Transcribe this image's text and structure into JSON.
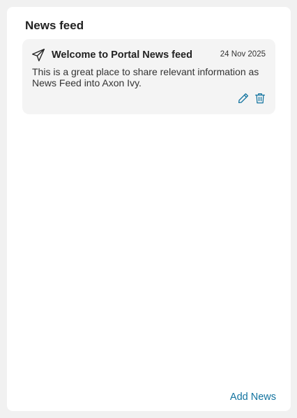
{
  "panel": {
    "title": "News feed",
    "add_news_label": "Add News"
  },
  "news_items": [
    {
      "icon": "send-icon",
      "title": "Welcome to Portal News feed",
      "date": "24 Nov 2025",
      "body": "This is a great place to share relevant information as News Feed into Axon Ivy.",
      "actions": [
        "edit-icon",
        "delete-icon"
      ]
    }
  ],
  "colors": {
    "accent": "#12739f",
    "card_background": "#f4f4f4",
    "page_background": "#f1f1f1"
  }
}
